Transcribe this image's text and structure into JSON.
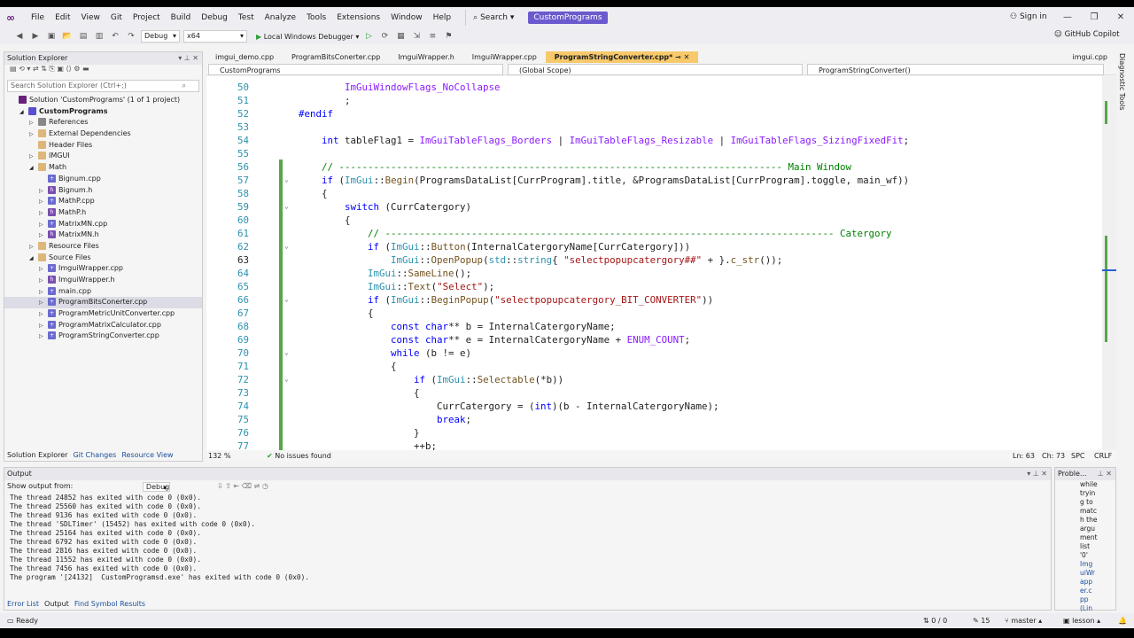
{
  "menu": {
    "items": [
      "File",
      "Edit",
      "View",
      "Git",
      "Project",
      "Build",
      "Debug",
      "Test",
      "Analyze",
      "Tools",
      "Extensions",
      "Window",
      "Help"
    ],
    "search_label": "Search",
    "solution_name": "CustomPrograms",
    "sign_in": "Sign in",
    "copilot": "GitHub Copilot"
  },
  "toolbar": {
    "config": "Debug",
    "platform": "x64",
    "run_label": "Local Windows Debugger"
  },
  "solution_explorer": {
    "title": "Solution Explorer",
    "search_placeholder": "Search Solution Explorer (Ctrl+;)",
    "items": [
      {
        "label": "Solution 'CustomPrograms' (1 of 1 project)",
        "icon": "sol",
        "indent": 0,
        "arrow": ""
      },
      {
        "label": "CustomPrograms",
        "icon": "proj",
        "indent": 1,
        "arrow": "◢",
        "bold": true
      },
      {
        "label": "References",
        "icon": "ref",
        "indent": 2,
        "arrow": "▷"
      },
      {
        "label": "External Dependencies",
        "icon": "folder",
        "indent": 2,
        "arrow": "▷"
      },
      {
        "label": "Header Files",
        "icon": "folder",
        "indent": 2,
        "arrow": ""
      },
      {
        "label": "IMGUI",
        "icon": "folder",
        "indent": 2,
        "arrow": "▷"
      },
      {
        "label": "Math",
        "icon": "folder",
        "indent": 2,
        "arrow": "◢"
      },
      {
        "label": "Bignum.cpp",
        "icon": "cpp",
        "indent": 3,
        "arrow": ""
      },
      {
        "label": "Bignum.h",
        "icon": "h",
        "indent": 3,
        "arrow": "▷"
      },
      {
        "label": "MathP.cpp",
        "icon": "cpp",
        "indent": 3,
        "arrow": "▷"
      },
      {
        "label": "MathP.h",
        "icon": "h",
        "indent": 3,
        "arrow": "▷"
      },
      {
        "label": "MatrixMN.cpp",
        "icon": "cpp",
        "indent": 3,
        "arrow": "▷"
      },
      {
        "label": "MatrixMN.h",
        "icon": "h",
        "indent": 3,
        "arrow": "▷"
      },
      {
        "label": "Resource Files",
        "icon": "folder",
        "indent": 2,
        "arrow": "▷"
      },
      {
        "label": "Source Files",
        "icon": "folder",
        "indent": 2,
        "arrow": "◢"
      },
      {
        "label": "ImguiWrapper.cpp",
        "icon": "cpp",
        "indent": 3,
        "arrow": "▷"
      },
      {
        "label": "ImguiWrapper.h",
        "icon": "h",
        "indent": 3,
        "arrow": "▷"
      },
      {
        "label": "main.cpp",
        "icon": "cpp",
        "indent": 3,
        "arrow": "▷"
      },
      {
        "label": "ProgramBitsConerter.cpp",
        "icon": "cpp",
        "indent": 3,
        "arrow": "▷",
        "selected": true
      },
      {
        "label": "ProgramMetricUnitConverter.cpp",
        "icon": "cpp",
        "indent": 3,
        "arrow": "▷"
      },
      {
        "label": "ProgramMatrixCalculator.cpp",
        "icon": "cpp",
        "indent": 3,
        "arrow": "▷"
      },
      {
        "label": "ProgramStringConverter.cpp",
        "icon": "cpp",
        "indent": 3,
        "arrow": "▷"
      }
    ],
    "bottom_tabs": [
      "Solution Explorer",
      "Git Changes",
      "Resource View"
    ]
  },
  "editor": {
    "tabs": [
      "imgui_demo.cpp",
      "ProgramBitsConerter.cpp",
      "ImguiWrapper.h",
      "ImguiWrapper.cpp",
      "ProgramStringConverter.cpp*",
      "imgui.cpp"
    ],
    "active_tab": 4,
    "nav_project": "CustomPrograms",
    "nav_scope": "(Global Scope)",
    "nav_member": "ProgramStringConverter()",
    "zoom": "132 %",
    "issues": "No issues found",
    "position": "Ln: 63",
    "column": "Ch: 73",
    "spc": "SPC",
    "eol": "CRLF",
    "lines": [
      {
        "n": "50",
        "html": "        ImGuiWindowFlags_NoCollapse"
      },
      {
        "n": "51",
        "html": "        ;"
      },
      {
        "n": "52",
        "html": "#endif"
      },
      {
        "n": "53",
        "html": ""
      },
      {
        "n": "54",
        "html": "    int tableFlag1 = ImGuiTableFlags_Borders | ImGuiTableFlags_Resizable | ImGuiTableFlags_SizingFixedFit;"
      },
      {
        "n": "55",
        "html": ""
      },
      {
        "n": "56",
        "html": "    // ----------------------------------------------------------------------------- Main Window"
      },
      {
        "n": "57",
        "html": "    if (ImGui::Begin(ProgramsDataList[CurrProgram].title, &ProgramsDataList[CurrProgram].toggle, main_wf))"
      },
      {
        "n": "58",
        "html": "    {"
      },
      {
        "n": "59",
        "html": "        switch (CurrCatergory)"
      },
      {
        "n": "60",
        "html": "        {"
      },
      {
        "n": "61",
        "html": "            // ------------------------------------------------------------------------------ Catergory"
      },
      {
        "n": "62",
        "html": "            if (ImGui::Button(InternalCatergoryName[CurrCatergory]))"
      },
      {
        "n": "63",
        "html": "                ImGui::OpenPopup(std::string{ \"selectpopupcatergory##\" + }.c_str());"
      },
      {
        "n": "64",
        "html": "            ImGui::SameLine();"
      },
      {
        "n": "65",
        "html": "            ImGui::Text(\"Select\");"
      },
      {
        "n": "66",
        "html": "            if (ImGui::BeginPopup(\"selectpopupcatergory_BIT_CONVERTER\"))"
      },
      {
        "n": "67",
        "html": "            {"
      },
      {
        "n": "68",
        "html": "                const char** b = InternalCatergoryName;"
      },
      {
        "n": "69",
        "html": "                const char** e = InternalCatergoryName + ENUM_COUNT;"
      },
      {
        "n": "70",
        "html": "                while (b != e)"
      },
      {
        "n": "71",
        "html": "                {"
      },
      {
        "n": "72",
        "html": "                    if (ImGui::Selectable(*b))"
      },
      {
        "n": "73",
        "html": "                    {"
      },
      {
        "n": "74",
        "html": "                        CurrCatergory = (int)(b - InternalCatergoryName);"
      },
      {
        "n": "75",
        "html": "                        break;"
      },
      {
        "n": "76",
        "html": "                    }"
      },
      {
        "n": "77",
        "html": "                    ++b;"
      }
    ]
  },
  "output": {
    "title": "Output",
    "show_from_label": "Show output from:",
    "show_from_value": "Debug",
    "lines": [
      "The thread 24852 has exited with code 0 (0x0).",
      "The thread 25560 has exited with code 0 (0x0).",
      "The thread 9136 has exited with code 0 (0x0).",
      "The thread 'SDLTimer' (15452) has exited with code 0 (0x0).",
      "The thread 25164 has exited with code 0 (0x0).",
      "The thread 6792 has exited with code 0 (0x0).",
      "The thread 2816 has exited with code 0 (0x0).",
      "The thread 11552 has exited with code 0 (0x0).",
      "The thread 7456 has exited with code 0 (0x0).",
      "The program '[24132]  CustomProgramsd.exe' has exited with code 0 (0x0)."
    ],
    "bottom_tabs": [
      "Error List",
      "Output",
      "Find Symbol Results"
    ]
  },
  "problems": {
    "title": "Proble...",
    "text": [
      "while",
      "tryin",
      "g to",
      "matc",
      "h the",
      "argu",
      "ment",
      "list",
      "'0'",
      "Img",
      "uiWr",
      "app",
      "er.c",
      "pp",
      "(Lin"
    ]
  },
  "statusbar": {
    "ready": "Ready",
    "updown": "0 / 0",
    "changes": "15",
    "branch": "master",
    "repo": "lesson"
  }
}
